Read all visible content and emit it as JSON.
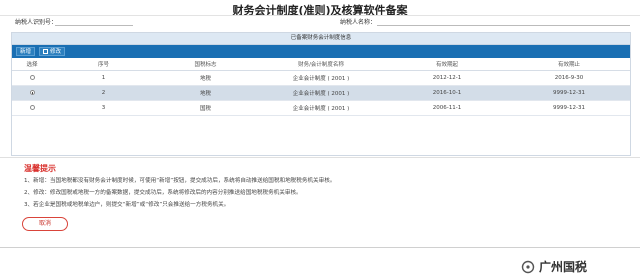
{
  "page": {
    "title": "财务会计制度(准则)及核算软件备案",
    "taxpayer_id_label": "纳税人识别号：",
    "taxpayer_name_label": "纳税人名称："
  },
  "panel": {
    "header": "已备案财务会计制度信息",
    "toolbar": {
      "new_label": "新增",
      "edit_label": "修改"
    },
    "columns": [
      "选择",
      "序号",
      "国税标志",
      "财务/会计制度名称",
      "有效期起",
      "有效期止"
    ],
    "rows": [
      {
        "seq": "1",
        "flag": "地税",
        "name": "企业会计制度 ( 2001 )",
        "start": "2012-12-1",
        "end": "2016-9-30",
        "selected": false
      },
      {
        "seq": "2",
        "flag": "地税",
        "name": "企业会计制度 ( 2001 )",
        "start": "2016-10-1",
        "end": "9999-12-31",
        "selected": true
      },
      {
        "seq": "3",
        "flag": "国税",
        "name": "企业会计制度 ( 2001 )",
        "start": "2006-11-1",
        "end": "9999-12-31",
        "selected": false
      }
    ]
  },
  "tips": {
    "title": "温馨提示",
    "items": [
      "1、新增：当国地税都没有财务会计制度时候，可使用“新增”按钮，提交成功后，系统将自动推送给国税和地税税务机关审核。",
      "2、修改：修改国税或地税一方的备案数据，提交成功后，系统将修改后的内容分别推送给国地税税务机关审核。",
      "3、若企业是国税或地税单边户，则提交“新增”或“修改”只会推送给一方税务机关。"
    ]
  },
  "actions": {
    "cancel_label": "取消"
  },
  "watermark": {
    "text": "广州国税"
  },
  "colors": {
    "toolbar": "#1a6fb3",
    "selected_row": "#d3dde8",
    "tips_title": "#d9302c"
  }
}
